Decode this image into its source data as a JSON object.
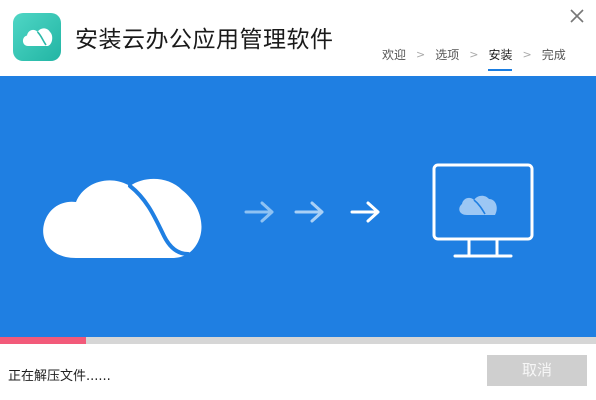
{
  "window": {
    "title": "安装云办公应用管理软件",
    "logo_icon": "cloud-logo-icon",
    "close_icon": "close-icon"
  },
  "steps": [
    {
      "label": "欢迎"
    },
    {
      "label": "选项"
    },
    {
      "label": "安装",
      "active": true
    },
    {
      "label": "完成"
    }
  ],
  "step_separator": ">",
  "banner": {
    "background": "#1f7fe2",
    "source_icon": "cloud-icon",
    "arrow_icons": [
      "arrow-right-icon",
      "arrow-right-icon",
      "arrow-right-icon"
    ],
    "target_icon": "monitor-icon"
  },
  "progress": {
    "fraction": 0.145,
    "fill_color": "#f25a7a",
    "track_color": "#d6d6d6"
  },
  "footer": {
    "status": "正在解压文件......",
    "cancel_label": "取消"
  }
}
